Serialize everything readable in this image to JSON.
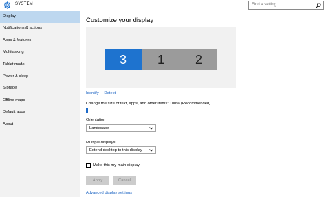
{
  "header": {
    "title": "SYSTEM",
    "search_placeholder": "Find a setting",
    "icon": "gear-icon"
  },
  "sidebar": {
    "items": [
      {
        "label": "Display",
        "active": true
      },
      {
        "label": "Notifications & actions",
        "active": false
      },
      {
        "label": "Apps & features",
        "active": false
      },
      {
        "label": "Multitasking",
        "active": false
      },
      {
        "label": "Tablet mode",
        "active": false
      },
      {
        "label": "Power & sleep",
        "active": false
      },
      {
        "label": "Storage",
        "active": false
      },
      {
        "label": "Offline maps",
        "active": false
      },
      {
        "label": "Default apps",
        "active": false
      },
      {
        "label": "About",
        "active": false
      }
    ]
  },
  "main": {
    "heading": "Customize your display",
    "monitors": [
      {
        "number": "3",
        "selected": true
      },
      {
        "number": "1",
        "selected": false
      },
      {
        "number": "2",
        "selected": false
      }
    ],
    "identify_label": "Identify",
    "detect_label": "Detect",
    "scale_label": "Change the size of text, apps, and other items: 100% (Recommended)",
    "scale_value": 100,
    "orientation_label": "Orientation",
    "orientation_value": "Landscape",
    "multiple_displays_label": "Multiple displays",
    "multiple_displays_value": "Extend desktop to this display",
    "main_display_label": "Make this my main display",
    "main_display_checked": false,
    "apply_label": "Apply",
    "cancel_label": "Cancel",
    "advanced_label": "Advanced display settings"
  },
  "colors": {
    "accent": "#1e73cf",
    "selected_nav": "#bdd7ef",
    "sidebar_bg": "#f2f2f2",
    "link": "#1c64c3"
  }
}
